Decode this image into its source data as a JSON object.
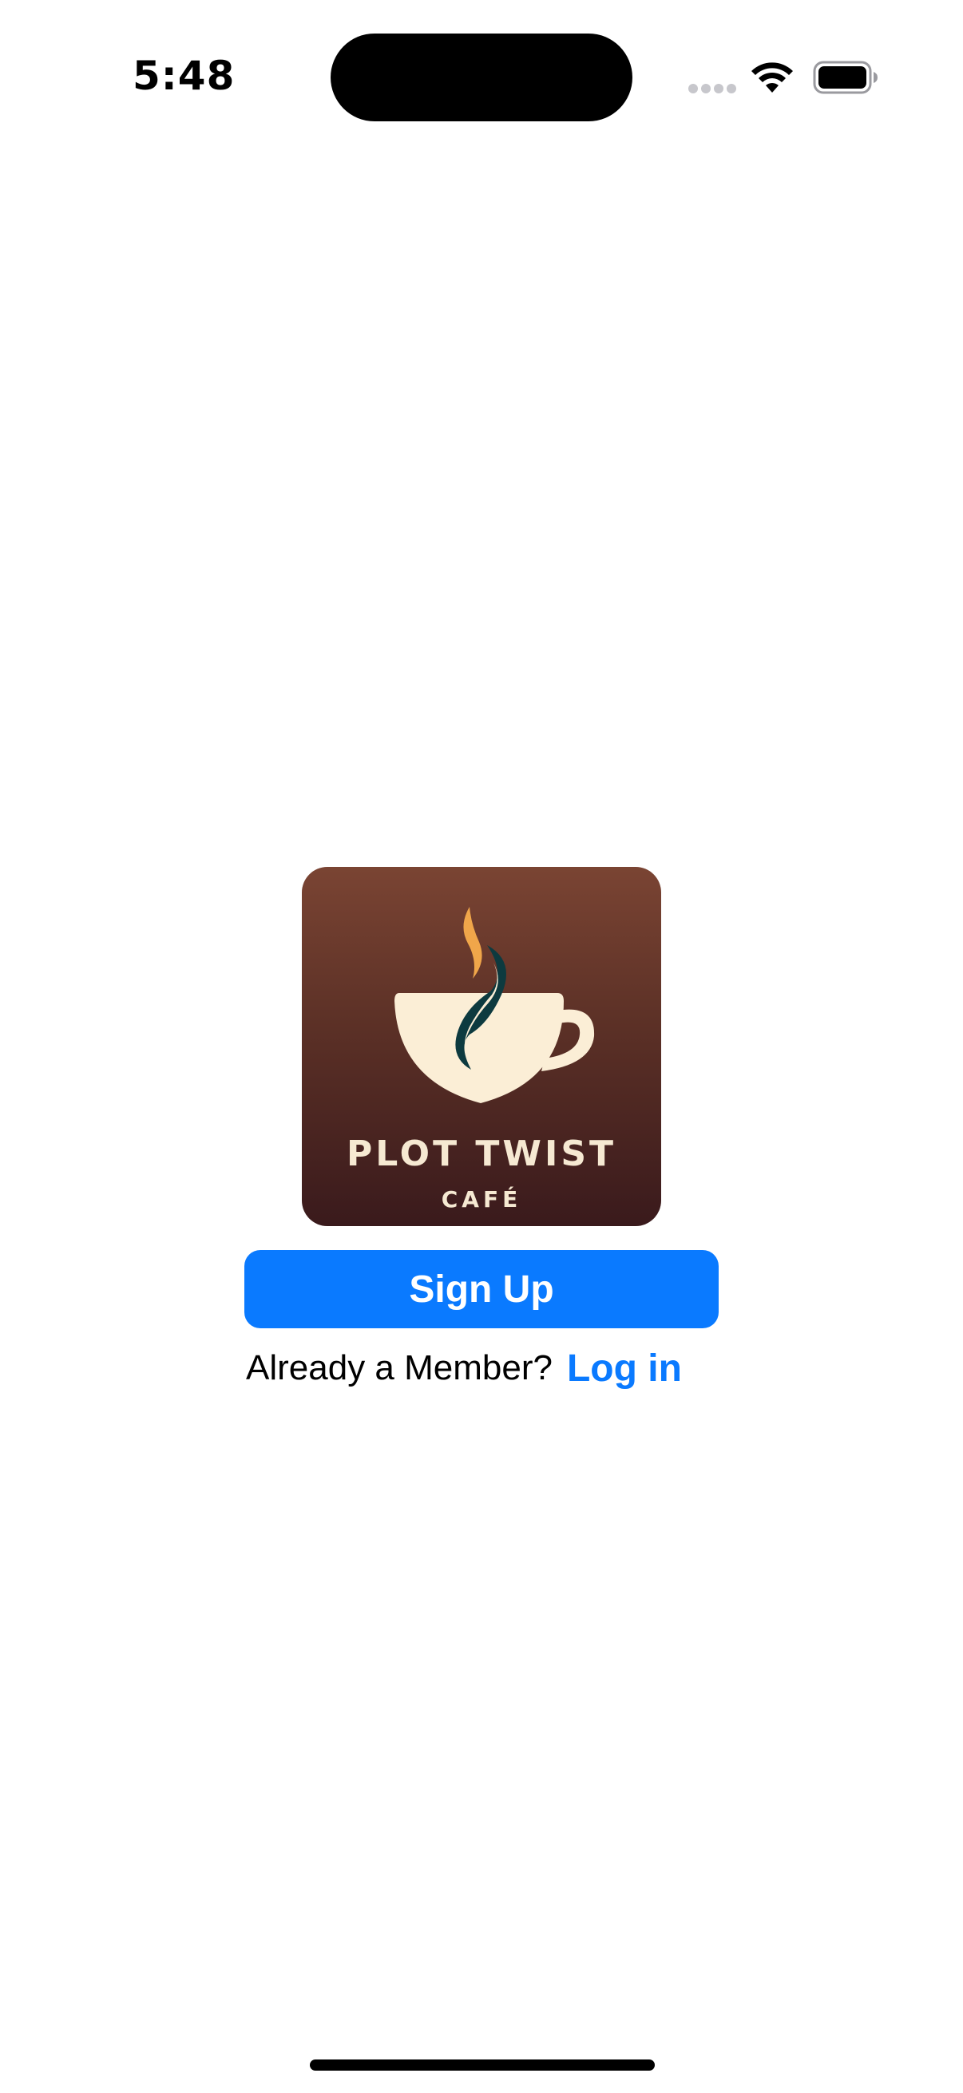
{
  "status_bar": {
    "time": "5:48",
    "icons": [
      "cellular-signal-icon",
      "wifi-icon",
      "battery-icon"
    ]
  },
  "logo": {
    "title": "PLOT TWIST",
    "subtitle": "CAFÉ",
    "icon": "coffee-cup-icon",
    "colors": {
      "background_top": "#7a4433",
      "background_bottom": "#3a1a1c",
      "cup": "#fbeed6",
      "steam_orange": "#f0a64a",
      "steam_teal": "#0d3a3f"
    }
  },
  "signup": {
    "label": "Sign Up"
  },
  "login": {
    "prompt": "Already a Member?",
    "link_label": "Log in"
  },
  "colors": {
    "accent": "#0a7aff",
    "background": "#ffffff"
  }
}
